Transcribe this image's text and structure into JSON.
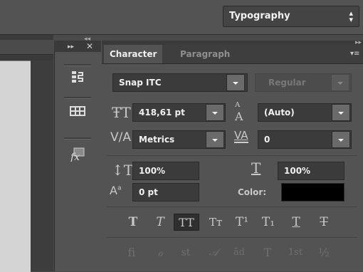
{
  "workspace": {
    "label": "Typography"
  },
  "panel": {
    "tabs": [
      "Character",
      "Paragraph"
    ],
    "font_family": "Snap ITC",
    "font_style": "Regular",
    "font_size": "418,61 pt",
    "leading": "(Auto)",
    "kerning": "Metrics",
    "tracking": "0",
    "vertical_scale": "100%",
    "horizontal_scale": "100%",
    "baseline_shift": "0 pt",
    "color_label": "Color:",
    "color_value": "#000000"
  },
  "style_buttons": [
    "T",
    "T",
    "TT",
    "Tт",
    "T¹",
    "T₁",
    "T",
    "T"
  ],
  "opentype_buttons": [
    "ﬁ",
    "ℴ",
    "st",
    "𝒜",
    "ād",
    "T",
    "1st",
    "½"
  ]
}
